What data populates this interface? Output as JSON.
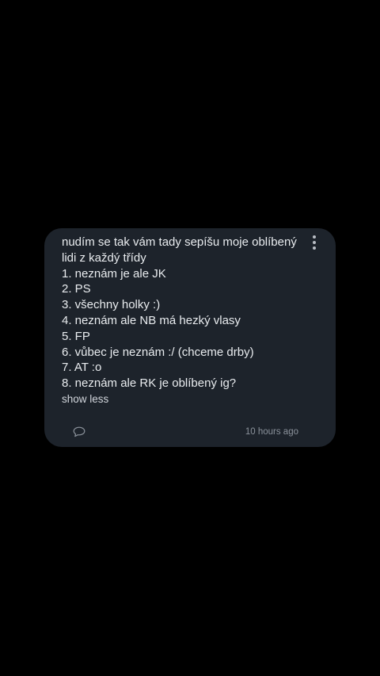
{
  "post": {
    "intro": "nudím se tak vám tady sepíšu moje oblíbený lidi z každý třídy",
    "items": [
      "1. neznám je ale JK",
      "2. PS",
      "3. všechny holky :)",
      "4. neznám ale NB má hezký vlasy",
      "5. FP",
      "6. vůbec je neznám :/ (chceme drby)",
      "7. AT :o",
      "8. neznám ale RK je oblíbený ig?"
    ],
    "toggle_label": "show less",
    "timestamp": "10 hours ago"
  },
  "icons": {
    "menu": "more-vertical-icon",
    "comment": "comment-icon"
  },
  "colors": {
    "background": "#000000",
    "card": "#1d232b",
    "text": "#e9ecef",
    "muted": "#8b929b"
  }
}
